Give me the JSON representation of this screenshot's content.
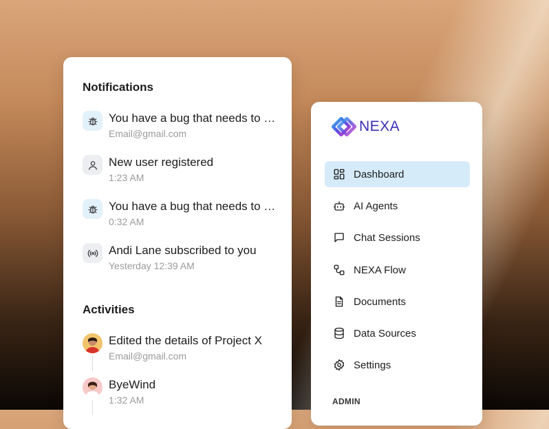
{
  "notifications": {
    "title": "Notifications",
    "items": [
      {
        "icon": "bug-icon",
        "title": "You have a bug that needs to be fixed",
        "subtitle": "Email@gmail.com"
      },
      {
        "icon": "user-icon",
        "title": "New user registered",
        "subtitle": "1:23 AM"
      },
      {
        "icon": "bug-icon",
        "title": "You have a bug that needs to be fixed",
        "subtitle": "0:32 AM"
      },
      {
        "icon": "broadcast-icon",
        "title": "Andi Lane subscribed to you",
        "subtitle": "Yesterday 12:39 AM"
      }
    ]
  },
  "activities": {
    "title": "Activities",
    "items": [
      {
        "avatar": "avatar-1",
        "title": "Edited the details of Project X",
        "subtitle": "Email@gmail.com"
      },
      {
        "avatar": "avatar-2",
        "title": "ByeWind",
        "subtitle": "1:32 AM"
      }
    ]
  },
  "sidebar": {
    "logo_text": "NEXA",
    "items": [
      {
        "icon": "dashboard-icon",
        "label": "Dashboard",
        "active": true
      },
      {
        "icon": "robot-icon",
        "label": "AI Agents"
      },
      {
        "icon": "chat-icon",
        "label": "Chat Sessions"
      },
      {
        "icon": "flow-icon",
        "label": "NEXA Flow"
      },
      {
        "icon": "document-icon",
        "label": "Documents"
      },
      {
        "icon": "database-icon",
        "label": "Data Sources"
      },
      {
        "icon": "gear-icon",
        "label": "Settings"
      }
    ],
    "admin_label": "ADMIN"
  },
  "colors": {
    "brand": "#3a2fb5",
    "active_bg": "#d6ebfa",
    "icon_bg": "#e3f1fb"
  }
}
